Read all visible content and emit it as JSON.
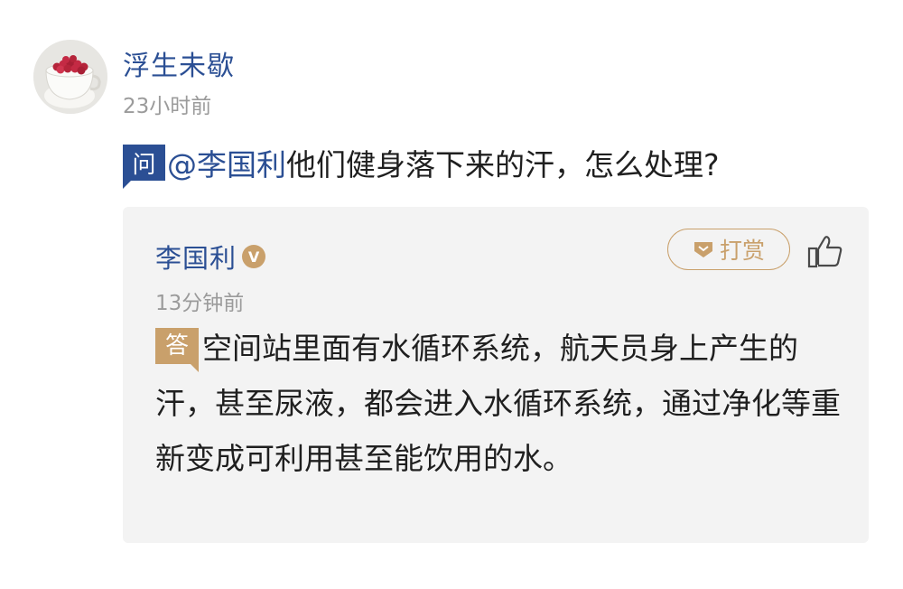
{
  "question": {
    "author": {
      "name": "浮生未歇",
      "time": "23小时前"
    },
    "badge": "问",
    "mention": "@李国利",
    "text": "他们健身落下来的汗，怎么处理?"
  },
  "answer": {
    "author": {
      "name": "李国利",
      "verified_badge": "V"
    },
    "time": "13分钟前",
    "tip_label": "打赏",
    "badge": "答",
    "text": "空间站里面有水循环系统，航天员身上产生的汗，甚至尿液，都会进入水循环系统，通过净化等重新变成可利用甚至能饮用的水。"
  },
  "icons": {
    "avatar": "teacup-with-red-berries-avatar",
    "tip": "gem-icon",
    "like": "thumbs-up-icon"
  },
  "colors": {
    "link_blue": "#2b4f94",
    "gold": "#c9a06b",
    "muted_gray": "#9b9b9b",
    "card_bg": "#f3f3f3"
  }
}
